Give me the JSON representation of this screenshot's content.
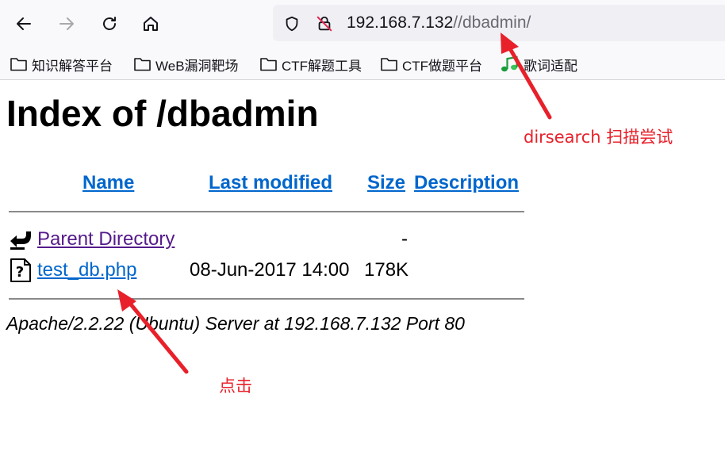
{
  "browser": {
    "url_host": "192.168.7.132",
    "url_path": "//dbadmin/",
    "icons": [
      "back-icon",
      "forward-icon",
      "reload-icon",
      "home-icon",
      "shield-icon",
      "insecure-lock-icon"
    ]
  },
  "bookmarks": [
    {
      "label": "知识解答平台",
      "icon": "folder-icon"
    },
    {
      "label": "WeB漏洞靶场",
      "icon": "folder-icon"
    },
    {
      "label": "CTF解题工具",
      "icon": "folder-icon"
    },
    {
      "label": "CTF做题平台",
      "icon": "folder-icon"
    },
    {
      "label": "歌词适配",
      "icon": "music-note-icon"
    }
  ],
  "page": {
    "title": "Index of /dbadmin",
    "columns": {
      "name": "Name",
      "last_modified": "Last modified",
      "size": "Size",
      "description": "Description"
    },
    "rows": [
      {
        "name": "Parent Directory",
        "modified": "",
        "size": "-",
        "icon": "back-folder-icon"
      },
      {
        "name": "test_db.php",
        "modified": "08-Jun-2017 14:00",
        "size": "178K",
        "icon": "unknown-file-icon"
      }
    ],
    "address": "Apache/2.2.22 (Ubuntu) Server at 192.168.7.132 Port 80"
  },
  "annotations": {
    "dirsearch": "dirsearch 扫描尝试",
    "click": "点击",
    "color": "#e8202a"
  }
}
